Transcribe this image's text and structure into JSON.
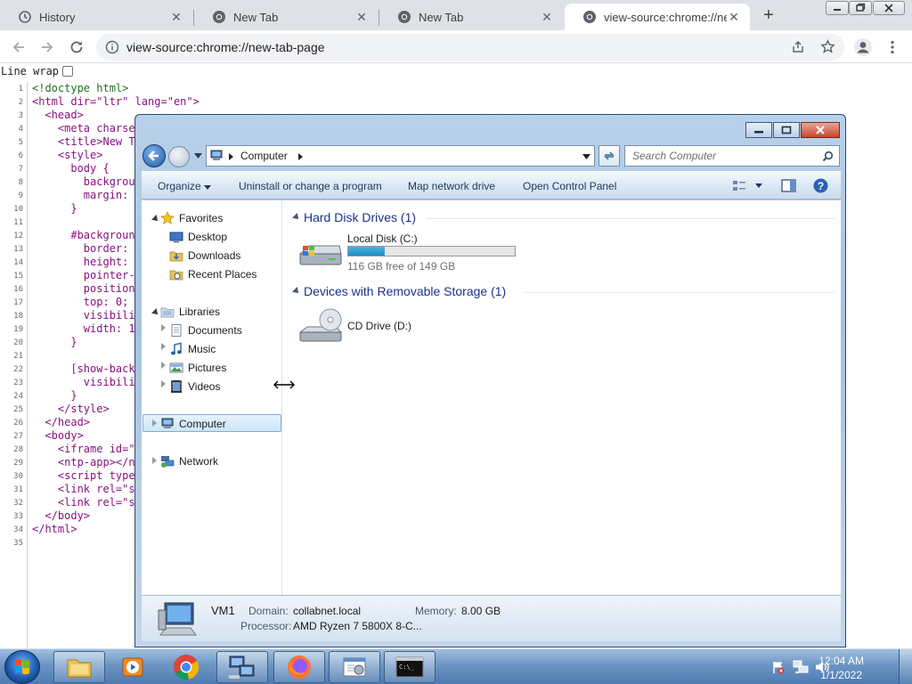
{
  "browser": {
    "tabs": [
      {
        "title": "History",
        "icon": "history-icon",
        "active": false
      },
      {
        "title": "New Tab",
        "icon": "chrome-icon",
        "active": false
      },
      {
        "title": "New Tab",
        "icon": "chrome-icon",
        "active": false
      },
      {
        "title": "view-source:chrome://new-tab-page",
        "icon": "chrome-icon",
        "active": true
      }
    ],
    "new_tab_label": "+",
    "url": "view-source:chrome://new-tab-page"
  },
  "view_source": {
    "line_wrap_label": "Line wrap",
    "line_numbers": [
      "1",
      "2",
      "3",
      "4",
      "5",
      "6",
      "7",
      "8",
      "9",
      "10",
      "11",
      "12",
      "13",
      "14",
      "15",
      "16",
      "17",
      "18",
      "19",
      "20",
      "21",
      "22",
      "23",
      "24",
      "25",
      "26",
      "27",
      "28",
      "29",
      "30",
      "31",
      "32",
      "33",
      "34",
      "35"
    ],
    "lines": [
      "<!doctype html>",
      "<html dir=\"ltr\" lang=\"en\">",
      "  <head>",
      "    <meta charse",
      "    <title>New T",
      "    <style>",
      "      body {",
      "        backgrou",
      "        margin:",
      "      }",
      "",
      "      #backgroun",
      "        border:",
      "        height:",
      "        pointer-",
      "        position",
      "        top: 0;",
      "        visibili",
      "        width: 1",
      "      }",
      "",
      "      [show-back",
      "        visibili",
      "      }",
      "    </style>",
      "  </head>",
      "  <body>",
      "    <iframe id=\"",
      "    <ntp-app></n",
      "    <script type",
      "    <link rel=\"s",
      "    <link rel=\"s",
      "  </body>",
      "</html>",
      ""
    ]
  },
  "explorer": {
    "address_path": "Computer",
    "search_placeholder": "Search Computer",
    "commands": {
      "organize": "Organize",
      "uninstall": "Uninstall or change a program",
      "map_drive": "Map network drive",
      "control_panel": "Open Control Panel"
    },
    "nav": {
      "favorites": "Favorites",
      "desktop": "Desktop",
      "downloads": "Downloads",
      "recent": "Recent Places",
      "libraries": "Libraries",
      "documents": "Documents",
      "music": "Music",
      "pictures": "Pictures",
      "videos": "Videos",
      "computer": "Computer",
      "network": "Network"
    },
    "groups": {
      "hdd": "Hard Disk Drives (1)",
      "removable": "Devices with Removable Storage (1)"
    },
    "drives": {
      "c_name": "Local Disk (C:)",
      "c_free": "116 GB free of 149 GB",
      "c_used_fraction": 0.22,
      "d_name": "CD Drive (D:)"
    },
    "status": {
      "name": "VM1",
      "domain_label": "Domain:",
      "domain": "collabnet.local",
      "memory_label": "Memory:",
      "memory": "8.00 GB",
      "processor_label": "Processor:",
      "processor": "AMD Ryzen 7 5800X 8-C..."
    }
  },
  "taskbar": {
    "time": "12:04 AM",
    "date": "1/1/2022"
  }
}
